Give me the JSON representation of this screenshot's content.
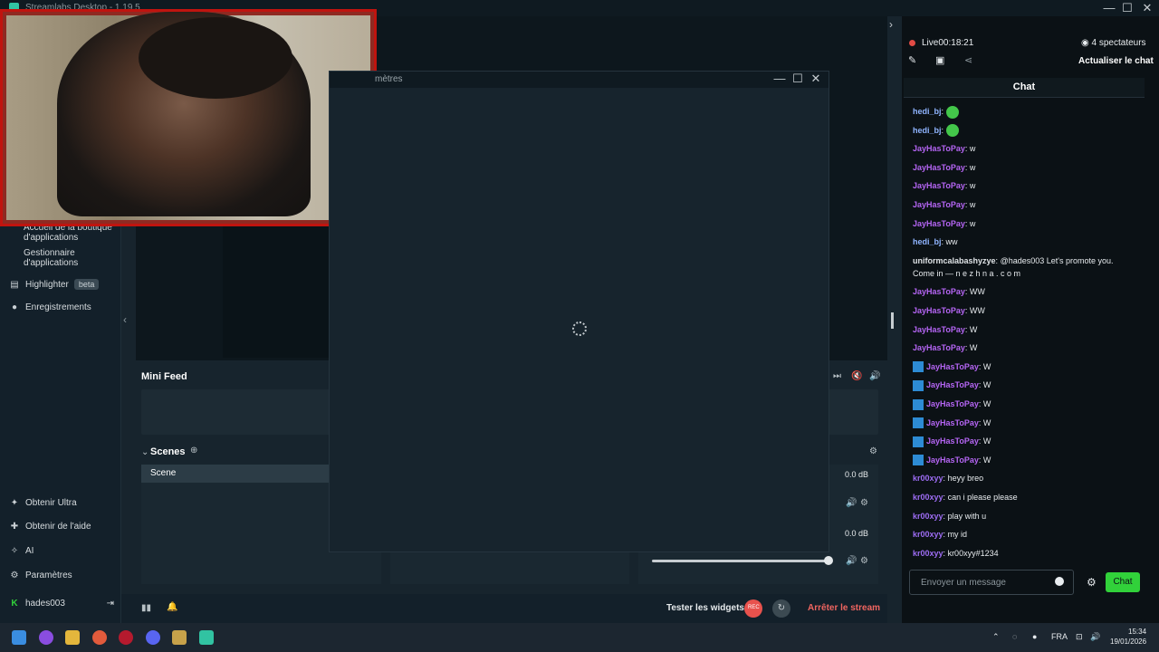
{
  "window": {
    "title": "Streamlabs Desktop - 1.19.5",
    "minimize": "—",
    "maximize": "☐",
    "close": "✕"
  },
  "sidebar": {
    "items": [
      {
        "label": "Accueil de la boutique d'applications",
        "icon": "store-icon"
      },
      {
        "label": "Gestionnaire d'applications",
        "icon": "apps-icon"
      },
      {
        "label": "Highlighter",
        "badge": "beta",
        "icon": "highlighter-icon"
      },
      {
        "label": "Enregistrements",
        "icon": "recordings-icon"
      }
    ],
    "bottom_items": [
      {
        "label": "Obtenir Ultra",
        "icon": "ultra-icon"
      },
      {
        "label": "Obtenir de l'aide",
        "icon": "help-icon"
      },
      {
        "label": "AI",
        "icon": "ai-icon"
      },
      {
        "label": "Paramètres",
        "icon": "gear-icon"
      },
      {
        "label": "hades003",
        "icon": "kick-icon"
      }
    ]
  },
  "editor": {
    "mini_feed_title": "Mini Feed",
    "scenes_title": "Scenes",
    "scenes": [
      "Scene"
    ],
    "mixer_values": [
      "0.0 dB",
      "0.0 dB"
    ],
    "test_widgets": "Tester les widgets",
    "rec_label": "REC",
    "stop_stream": "Arrêter le stream"
  },
  "modal": {
    "title": "mètres"
  },
  "chat": {
    "live_label": "Live",
    "live_time": "00:18:21",
    "viewers": "4 spectateurs",
    "refresh": "Actualiser le chat",
    "tab": "Chat",
    "placeholder": "Envoyer un message",
    "send": "Chat",
    "messages": [
      {
        "user": "hedi_bj",
        "text": "",
        "emote": true,
        "color": "#8fb4ff"
      },
      {
        "user": "hedi_bj",
        "text": "",
        "emote": true,
        "color": "#8fb4ff"
      },
      {
        "user": "JayHasToPay",
        "text": "w",
        "color": "#b565f4"
      },
      {
        "user": "JayHasToPay",
        "text": "w",
        "color": "#b565f4"
      },
      {
        "user": "JayHasToPay",
        "text": "w",
        "color": "#b565f4"
      },
      {
        "user": "JayHasToPay",
        "text": "w",
        "color": "#b565f4"
      },
      {
        "user": "JayHasToPay",
        "text": "w",
        "color": "#b565f4"
      },
      {
        "user": "hedi_bj",
        "text": "ww",
        "color": "#8fb4ff"
      },
      {
        "user": "uniformcalabashyzye",
        "text": "@hades003 Let's promote you.",
        "text2": "Come in — n e z h n a . c o m",
        "color": "#dfe3e6"
      },
      {
        "user": "JayHasToPay",
        "text": "WW",
        "color": "#b565f4"
      },
      {
        "user": "JayHasToPay",
        "text": "WW",
        "color": "#b565f4"
      },
      {
        "user": "JayHasToPay",
        "text": "W",
        "color": "#b565f4"
      },
      {
        "user": "JayHasToPay",
        "text": "W",
        "color": "#b565f4"
      },
      {
        "user": "JayHasToPay",
        "text": "W",
        "prime": true,
        "color": "#b565f4"
      },
      {
        "user": "JayHasToPay",
        "text": "W",
        "prime": true,
        "color": "#b565f4"
      },
      {
        "user": "JayHasToPay",
        "text": "W",
        "prime": true,
        "color": "#b565f4"
      },
      {
        "user": "JayHasToPay",
        "text": "W",
        "prime": true,
        "color": "#b565f4"
      },
      {
        "user": "JayHasToPay",
        "text": "W",
        "prime": true,
        "color": "#b565f4"
      },
      {
        "user": "JayHasToPay",
        "text": "W",
        "prime": true,
        "color": "#b565f4"
      },
      {
        "user": "kr00xyy",
        "text": "heyy breo",
        "color": "#9d6cf3"
      },
      {
        "user": "kr00xyy",
        "text": "can i please please",
        "color": "#9d6cf3"
      },
      {
        "user": "kr00xyy",
        "text": "play with u",
        "color": "#9d6cf3"
      },
      {
        "user": "kr00xyy",
        "text": "my id",
        "color": "#9d6cf3"
      },
      {
        "user": "kr00xyy",
        "text": "kr00xyy#1234",
        "color": "#9d6cf3"
      }
    ]
  },
  "taskbar": {
    "lang": "FRA",
    "time": "15:34",
    "date": "19/01/2026"
  }
}
